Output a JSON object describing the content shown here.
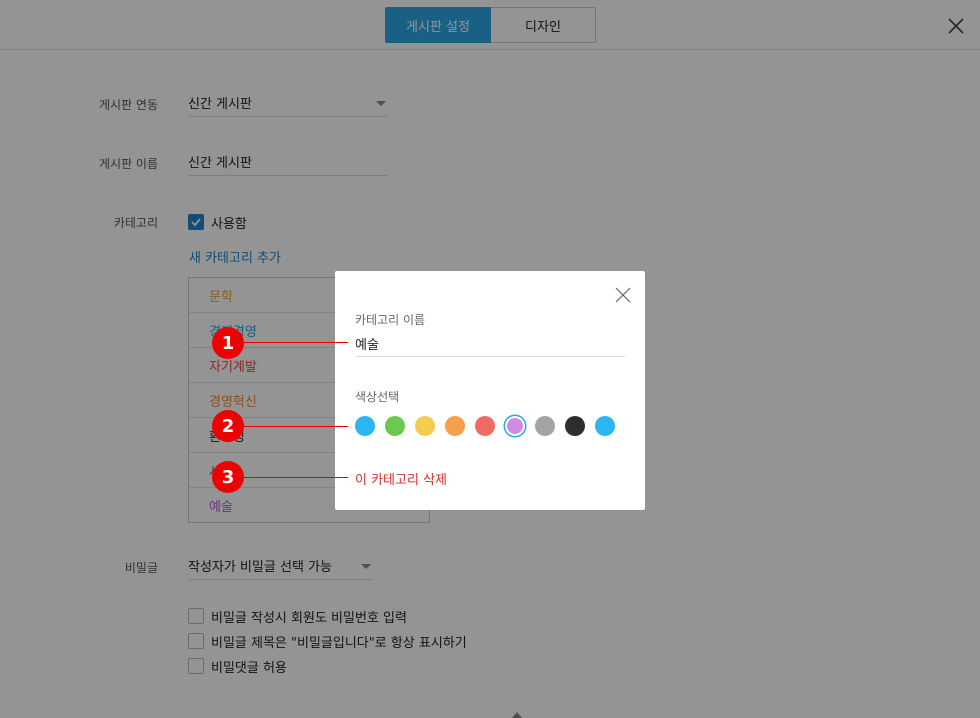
{
  "header": {
    "tabs": [
      {
        "label": "게시판 설정",
        "active": true
      },
      {
        "label": "디자인",
        "active": false
      }
    ]
  },
  "form": {
    "board_link": {
      "label": "게시판 연동",
      "value": "신간 게시판"
    },
    "board_name": {
      "label": "게시판 이름",
      "value": "신간 게시판"
    },
    "category": {
      "label": "카테고리",
      "use_label": "사용함",
      "use_checked": true,
      "add_link": "새 카테고리 추가",
      "items": [
        {
          "label": "문학",
          "color": "#e6a23c"
        },
        {
          "label": "경제경영",
          "color": "#2ba5e6"
        },
        {
          "label": "자기계발",
          "color": "#e64a4a"
        },
        {
          "label": "경영혁신",
          "color": "#f08a35"
        },
        {
          "label": "환경정",
          "color": "#222222"
        },
        {
          "label": "사회",
          "color": "#777777"
        },
        {
          "label": "예술",
          "color": "#b55fd8"
        }
      ]
    },
    "secret": {
      "label": "비밀글",
      "value": "작성자가 비밀글 선택 가능",
      "options": [
        {
          "label": "비밀글 작성시 회원도 비밀번호 입력",
          "checked": false
        },
        {
          "label": "비밀글 제목은 \"비밀글입니다\"로 항상 표시하기",
          "checked": false
        },
        {
          "label": "비밀댓글 허용",
          "checked": false
        }
      ]
    }
  },
  "modal": {
    "name_label": "카테고리 이름",
    "name_value": "예술",
    "color_label": "색상선택",
    "colors": [
      "#2bb5f5",
      "#6cc84f",
      "#f4cd50",
      "#f5a04c",
      "#f26a63",
      "#d08ae8",
      "#a3a3a3",
      "#2e2e2e",
      "#2bb5f5"
    ],
    "selected_color_index": 5,
    "delete_label": "이 카테고리 삭제"
  },
  "callouts": [
    "1",
    "2",
    "3"
  ]
}
